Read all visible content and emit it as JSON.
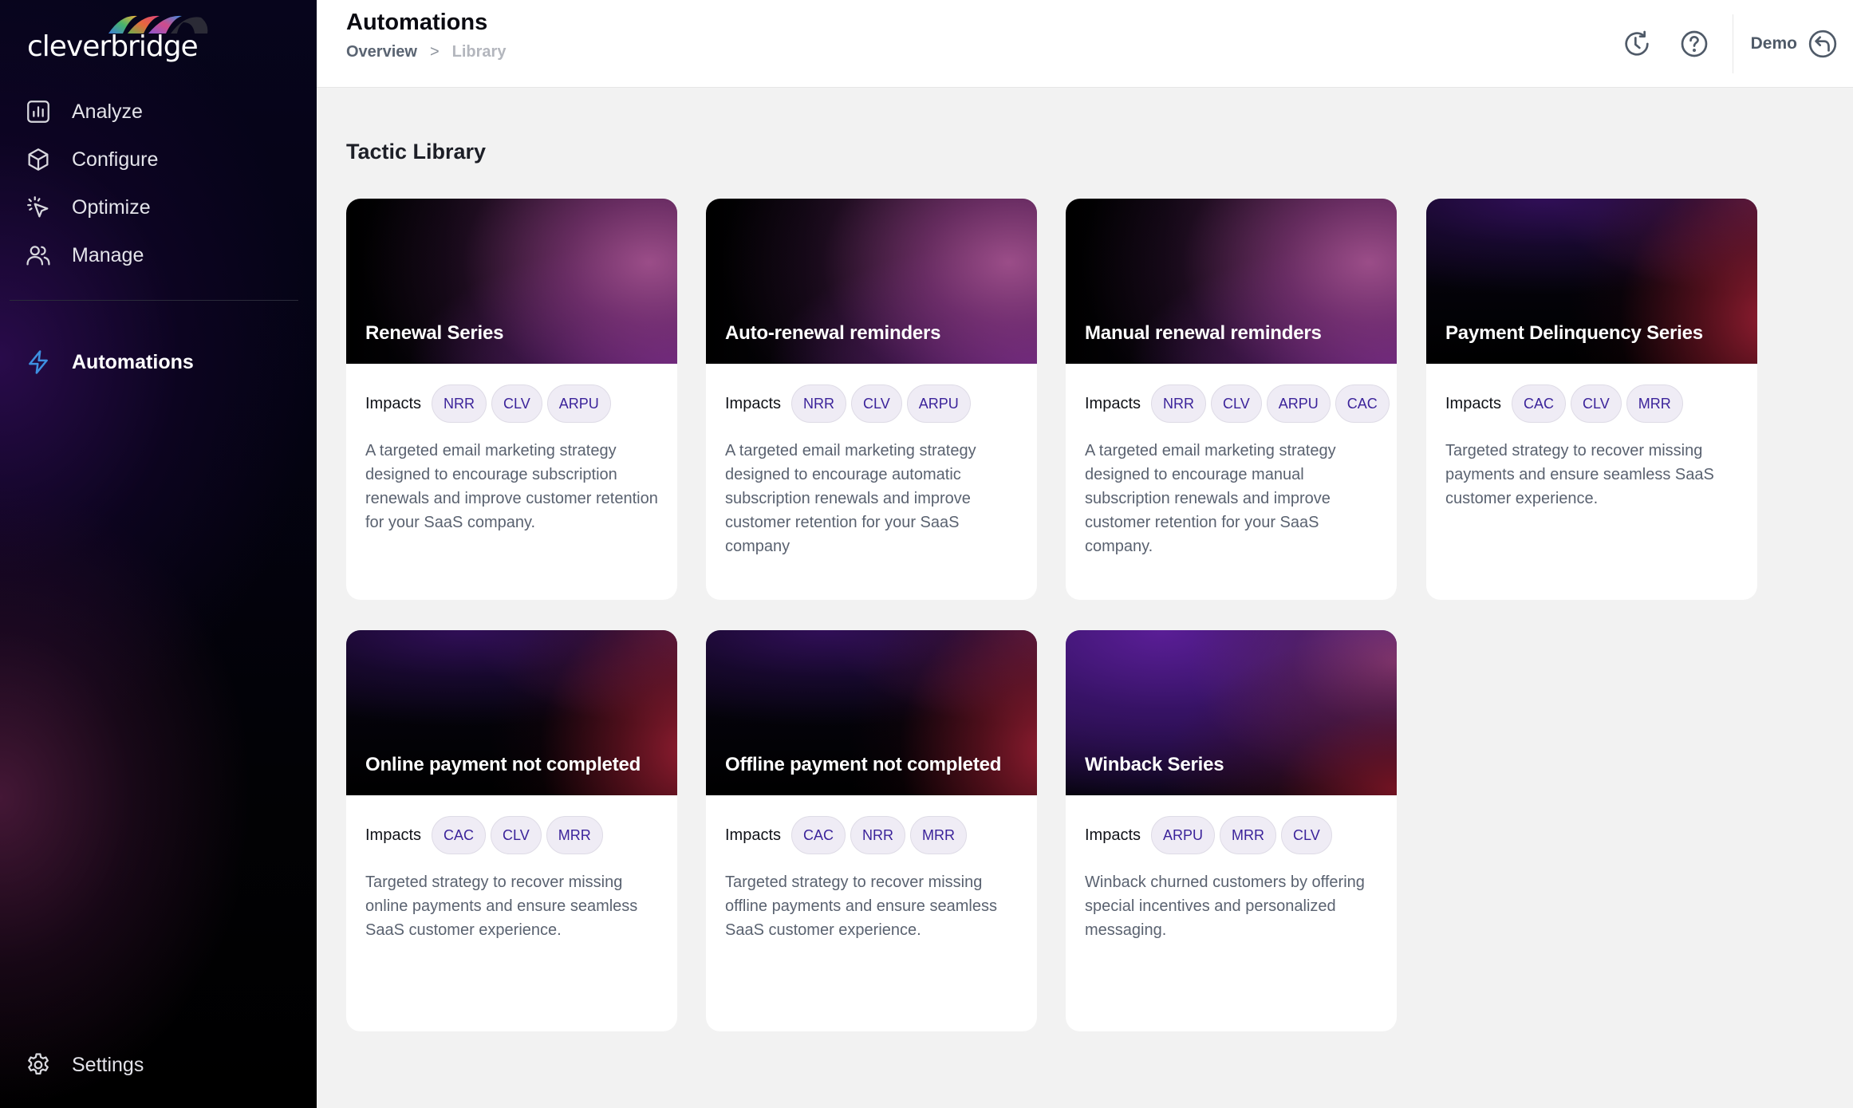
{
  "app": {
    "brand": "cleverbridge"
  },
  "sidebar": {
    "items": [
      {
        "label": "Analyze",
        "icon": "bar-chart-icon"
      },
      {
        "label": "Configure",
        "icon": "cube-icon"
      },
      {
        "label": "Optimize",
        "icon": "cursor-click-icon"
      },
      {
        "label": "Manage",
        "icon": "users-icon"
      }
    ],
    "active_item": {
      "label": "Automations",
      "icon": "lightning-icon",
      "accent_color": "#3d8fe0"
    },
    "settings": {
      "label": "Settings",
      "icon": "gear-icon"
    }
  },
  "header": {
    "title": "Automations",
    "breadcrumb": [
      {
        "label": "Overview"
      },
      {
        "label": "Library"
      }
    ],
    "breadcrumb_separator": ">",
    "actions": {
      "history_icon": "history-icon",
      "help_icon": "help-icon",
      "user_name": "Demo",
      "back_icon": "undo-arrow-icon"
    }
  },
  "main": {
    "section_title": "Tactic Library",
    "impacts_label": "Impacts",
    "cards": [
      {
        "title": "Renewal Series",
        "theme": "purple",
        "impacts": [
          "NRR",
          "CLV",
          "ARPU"
        ],
        "description": "A targeted email marketing strategy designed to encourage subscription renewals and improve customer retention for your SaaS company."
      },
      {
        "title": "Auto-renewal reminders",
        "theme": "purple",
        "impacts": [
          "NRR",
          "CLV",
          "ARPU"
        ],
        "description": "A targeted email marketing strategy designed to encourage automatic subscription renewals and improve customer retention for your SaaS company"
      },
      {
        "title": "Manual renewal reminders",
        "theme": "purple",
        "impacts": [
          "NRR",
          "CLV",
          "ARPU",
          "CAC"
        ],
        "description": "A targeted email marketing strategy designed to encourage manual subscription renewals and improve customer retention for your SaaS company."
      },
      {
        "title": "Payment Delinquency Series",
        "theme": "red",
        "impacts": [
          "CAC",
          "CLV",
          "MRR"
        ],
        "description": "Targeted strategy to recover missing payments and ensure seamless SaaS customer experience."
      },
      {
        "title": "Online payment not completed",
        "theme": "red",
        "impacts": [
          "CAC",
          "CLV",
          "MRR"
        ],
        "description": "Targeted strategy to recover missing online payments and ensure seamless SaaS customer experience."
      },
      {
        "title": "Offline payment not completed",
        "theme": "red",
        "impacts": [
          "CAC",
          "NRR",
          "MRR"
        ],
        "description": "Targeted strategy to recover missing offline payments and ensure seamless SaaS customer experience."
      },
      {
        "title": "Winback Series",
        "theme": "winback",
        "impacts": [
          "ARPU",
          "MRR",
          "CLV"
        ],
        "description": "Winback churned customers by offering special incentives and personalized messaging."
      }
    ]
  },
  "colors": {
    "chip_text": "#3b239a",
    "chip_bg": "#efecf5",
    "page_bg": "#f2f2f2",
    "accent_blue": "#3d8fe0"
  }
}
